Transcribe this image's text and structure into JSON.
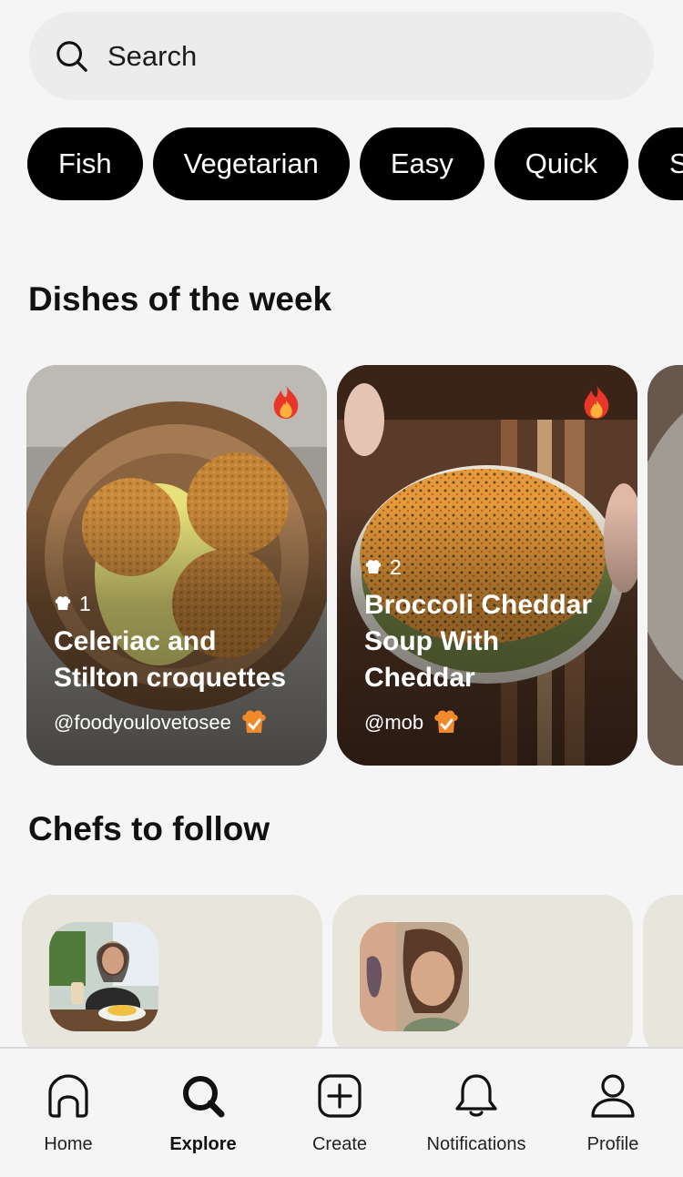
{
  "search": {
    "placeholder": "Search",
    "icon": "search-icon"
  },
  "filters": [
    "Fish",
    "Vegetarian",
    "Easy",
    "Quick",
    "S"
  ],
  "sections": {
    "dishes_title": "Dishes of the week",
    "chefs_title": "Chefs to follow"
  },
  "dishes": [
    {
      "rank": "1",
      "title_line1": "Celeriac and",
      "title_line2": "Stilton croquettes",
      "title_line3": "",
      "author": "@foodyoulovetosee",
      "badge": "fire-icon"
    },
    {
      "rank": "2",
      "title_line1": "Broccoli Cheddar",
      "title_line2": "Soup With",
      "title_line3": "Cheddar",
      "author": "@mob",
      "badge": "fire-icon"
    }
  ],
  "nav": {
    "items": [
      {
        "label": "Home",
        "icon": "home-icon"
      },
      {
        "label": "Explore",
        "icon": "explore-icon",
        "active": true
      },
      {
        "label": "Create",
        "icon": "create-icon"
      },
      {
        "label": "Notifications",
        "icon": "bell-icon"
      },
      {
        "label": "Profile",
        "icon": "profile-icon"
      }
    ]
  },
  "colors": {
    "background": "#f5f5f5",
    "chip": "#000000",
    "chef_card": "#e8e6dc",
    "search_bg": "#ececec"
  }
}
